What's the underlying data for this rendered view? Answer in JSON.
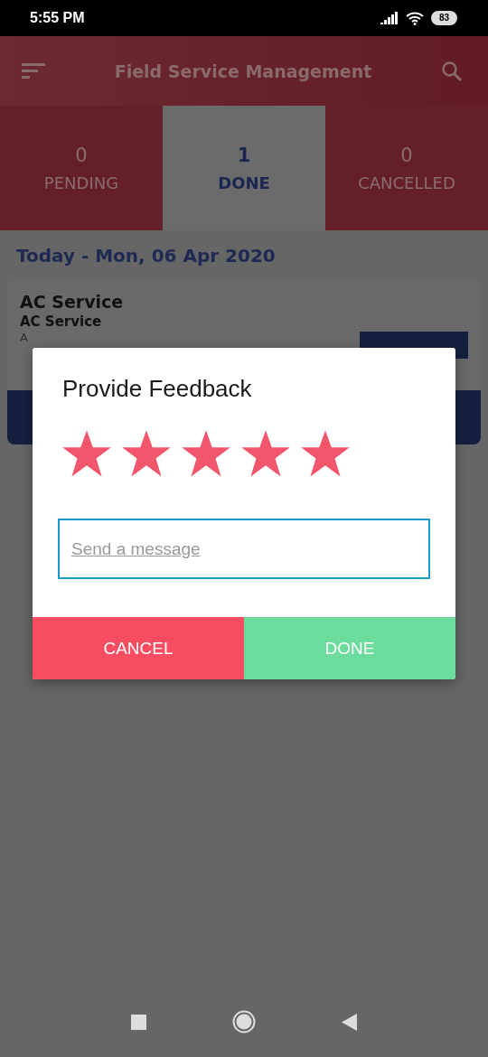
{
  "status_bar": {
    "time": "5:55 PM",
    "battery": "83"
  },
  "app_bar": {
    "title": "Field Service Management"
  },
  "tabs": [
    {
      "count": "0",
      "label": "PENDING",
      "selected": false
    },
    {
      "count": "1",
      "label": "DONE",
      "selected": true
    },
    {
      "count": "0",
      "label": "CANCELLED",
      "selected": false
    }
  ],
  "date_heading": "Today - Mon, 06 Apr 2020",
  "card": {
    "title": "AC Service",
    "subtitle": "AC Service",
    "detail": "A"
  },
  "dialog": {
    "title": "Provide Feedback",
    "stars": 5,
    "message": {
      "placeholder": "Send a message"
    },
    "buttons": [
      {
        "label": "CANCEL",
        "kind": "cancel"
      },
      {
        "label": "DONE",
        "kind": "confirm"
      }
    ]
  }
}
